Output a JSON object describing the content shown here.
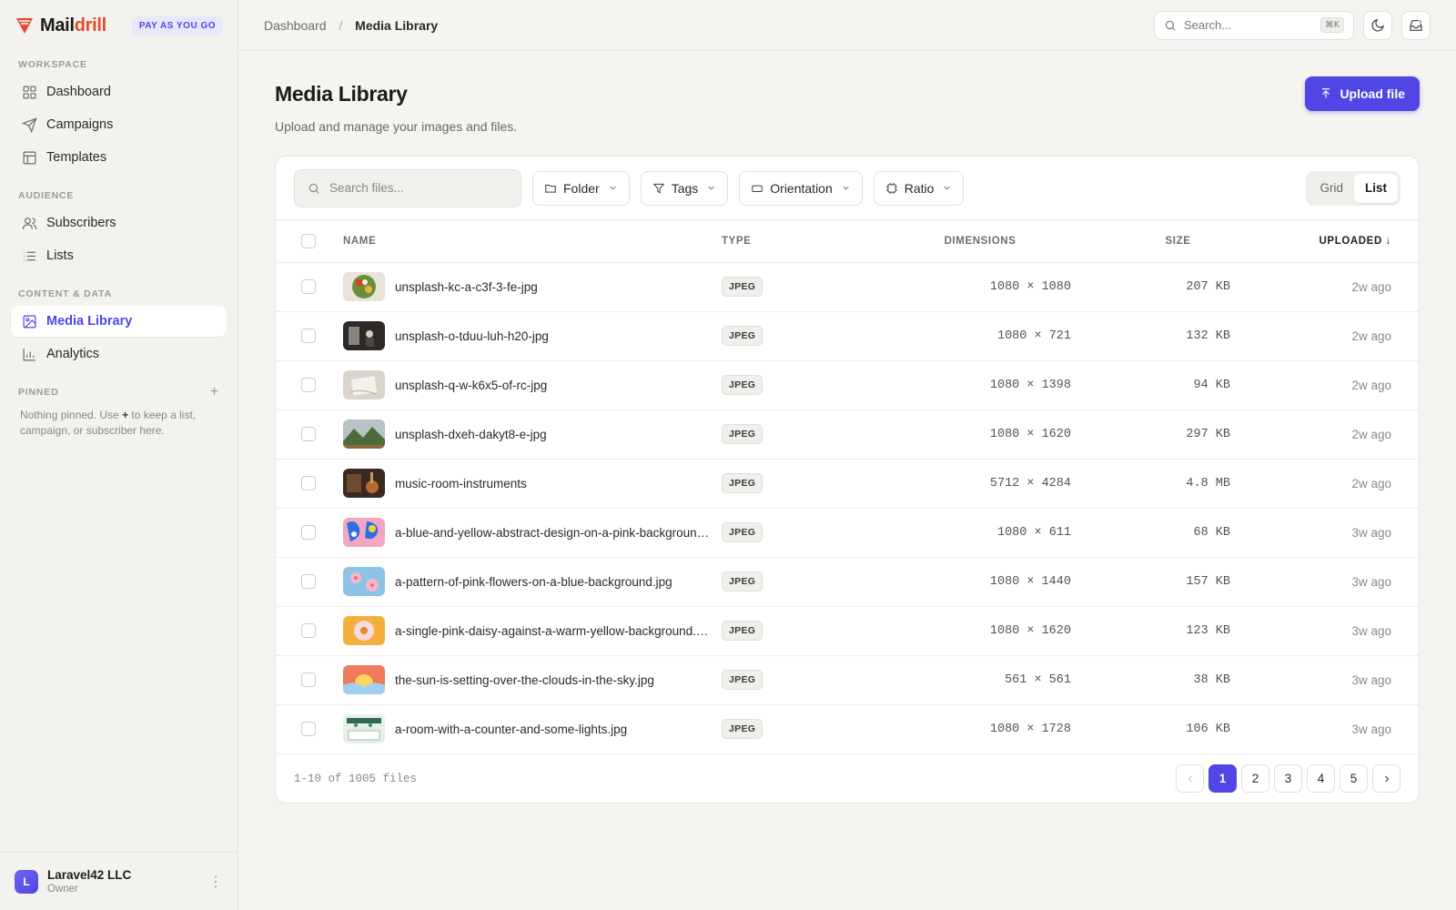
{
  "brand": {
    "name_main": "Mail",
    "name_accent": "drill",
    "plan_badge": "PAY AS YOU GO",
    "accent": "#e24b2c"
  },
  "sidebar": {
    "sections": [
      {
        "label": "WORKSPACE",
        "items": [
          {
            "label": "Dashboard",
            "icon": "grid-icon"
          },
          {
            "label": "Campaigns",
            "icon": "send-icon"
          },
          {
            "label": "Templates",
            "icon": "layout-icon"
          }
        ]
      },
      {
        "label": "AUDIENCE",
        "items": [
          {
            "label": "Subscribers",
            "icon": "users-icon"
          },
          {
            "label": "Lists",
            "icon": "list-icon"
          }
        ]
      },
      {
        "label": "CONTENT & DATA",
        "items": [
          {
            "label": "Media Library",
            "icon": "image-icon",
            "active": true
          },
          {
            "label": "Analytics",
            "icon": "bar-chart-icon"
          }
        ]
      }
    ],
    "pinned": {
      "label": "PINNED",
      "empty_pre": "Nothing pinned. Use ",
      "empty_plus": "+",
      "empty_post": " to keep a list, campaign, or subscriber here."
    },
    "footer": {
      "avatar_letter": "L",
      "org_name": "Laravel42 LLC",
      "role": "Owner"
    }
  },
  "topbar": {
    "breadcrumb": [
      "Dashboard",
      "Media Library"
    ],
    "search_placeholder": "Search...",
    "search_shortcut": "⌘K"
  },
  "page": {
    "title": "Media Library",
    "subtitle": "Upload and manage your images and files.",
    "upload_label": "Upload file",
    "accent": "#4f46e5"
  },
  "toolbar": {
    "search_placeholder": "Search files...",
    "filters": [
      "Folder",
      "Tags",
      "Orientation",
      "Ratio"
    ],
    "view_options": [
      "Grid",
      "List"
    ],
    "active_view": "List"
  },
  "table": {
    "columns": {
      "name": "NAME",
      "type": "TYPE",
      "dimensions": "DIMENSIONS",
      "size": "SIZE",
      "uploaded": "UPLOADED ↓"
    },
    "rows": [
      {
        "name": "unsplash-kc-a-c3f-3-fe-jpg",
        "type": "JPEG",
        "dimensions": "1080 × 1080",
        "size": "207 KB",
        "uploaded": "2w ago",
        "thumb": "bowl"
      },
      {
        "name": "unsplash-o-tduu-luh-h20-jpg",
        "type": "JPEG",
        "dimensions": "1080 × 721",
        "size": "132 KB",
        "uploaded": "2w ago",
        "thumb": "dark-room"
      },
      {
        "name": "unsplash-q-w-k6x5-of-rc-jpg",
        "type": "JPEG",
        "dimensions": "1080 × 1398",
        "size": "94 KB",
        "uploaded": "2w ago",
        "thumb": "paper"
      },
      {
        "name": "unsplash-dxeh-dakyt8-e-jpg",
        "type": "JPEG",
        "dimensions": "1080 × 1620",
        "size": "297 KB",
        "uploaded": "2w ago",
        "thumb": "mountain"
      },
      {
        "name": "music-room-instruments",
        "type": "JPEG",
        "dimensions": "5712 × 4284",
        "size": "4.8 MB",
        "uploaded": "2w ago",
        "thumb": "music"
      },
      {
        "name": "a-blue-and-yellow-abstract-design-on-a-pink-background.jpg",
        "type": "JPEG",
        "dimensions": "1080 × 611",
        "size": "68 KB",
        "uploaded": "3w ago",
        "thumb": "abstract"
      },
      {
        "name": "a-pattern-of-pink-flowers-on-a-blue-background.jpg",
        "type": "JPEG",
        "dimensions": "1080 × 1440",
        "size": "157 KB",
        "uploaded": "3w ago",
        "thumb": "flowers"
      },
      {
        "name": "a-single-pink-daisy-against-a-warm-yellow-background.jpg",
        "type": "JPEG",
        "dimensions": "1080 × 1620",
        "size": "123 KB",
        "uploaded": "3w ago",
        "thumb": "daisy"
      },
      {
        "name": "the-sun-is-setting-over-the-clouds-in-the-sky.jpg",
        "type": "JPEG",
        "dimensions": "561 × 561",
        "size": "38 KB",
        "uploaded": "3w ago",
        "thumb": "sunset"
      },
      {
        "name": "a-room-with-a-counter-and-some-lights.jpg",
        "type": "JPEG",
        "dimensions": "1080 × 1728",
        "size": "106 KB",
        "uploaded": "3w ago",
        "thumb": "room"
      }
    ]
  },
  "footer": {
    "count_text": "1-10 of 1005 files",
    "pages": [
      "1",
      "2",
      "3",
      "4",
      "5"
    ],
    "current_page": "1"
  }
}
